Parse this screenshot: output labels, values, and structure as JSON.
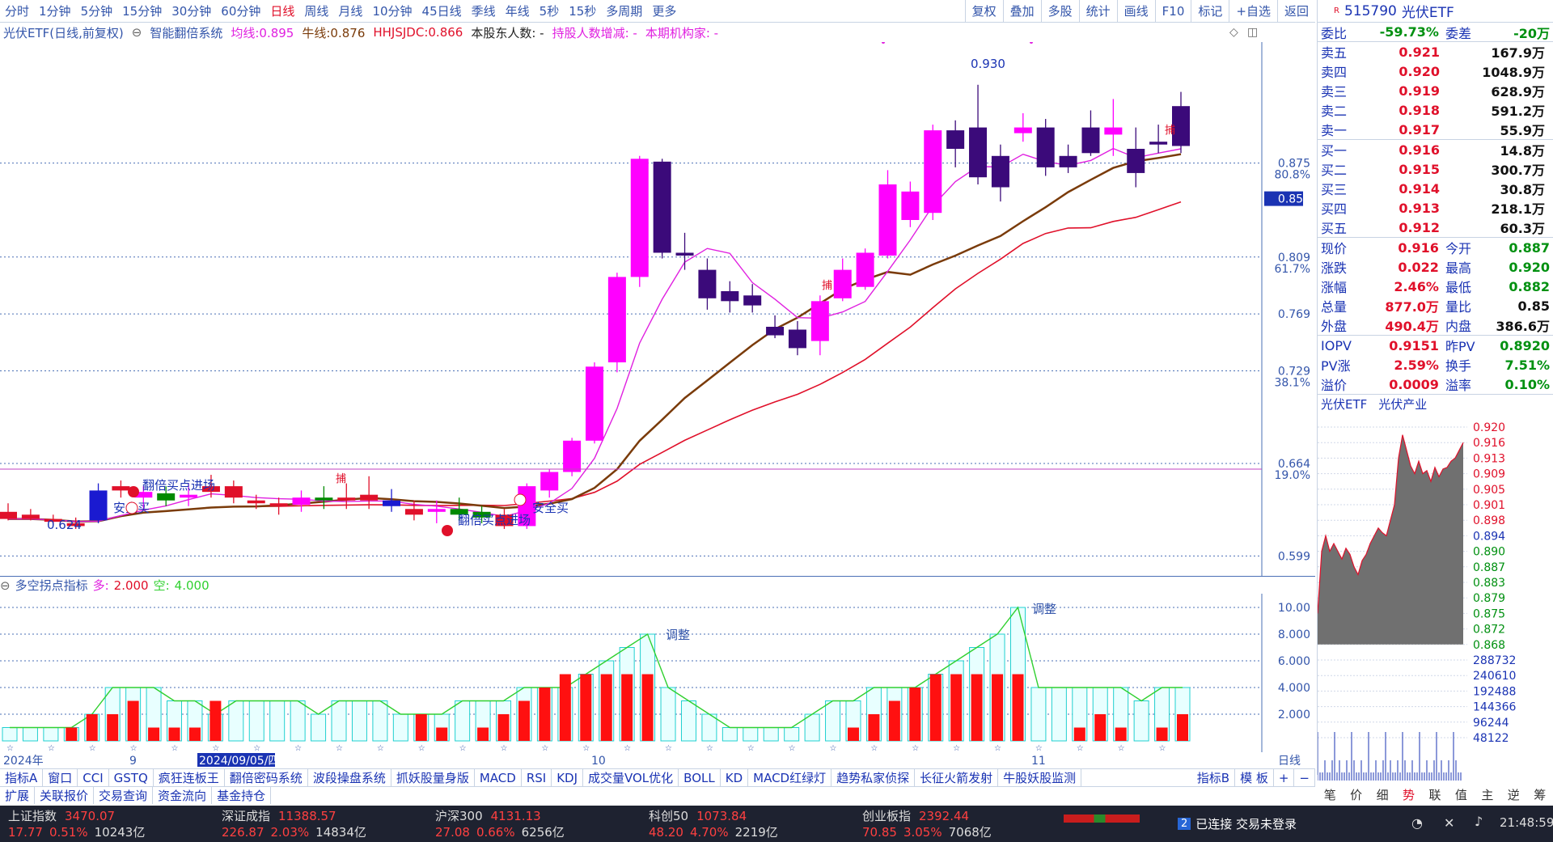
{
  "topbar": {
    "periods": [
      "分时",
      "1分钟",
      "5分钟",
      "15分钟",
      "30分钟",
      "60分钟",
      "日线",
      "周线",
      "月线",
      "10分钟",
      "45日线",
      "季线",
      "年线",
      "5秒",
      "15秒",
      "多周期",
      "更多"
    ],
    "active_period": "日线",
    "tools": [
      "复权",
      "叠加",
      "多股",
      "统计",
      "画线",
      "F10",
      "标记",
      "+自选",
      "返回"
    ]
  },
  "title": {
    "name": "光伏ETF(日线,前复权)",
    "system": "智能翻倍系统",
    "ma_label": "均线:",
    "ma_value": "0.895",
    "niu_label": "牛线:",
    "niu_value": "0.876",
    "hh_label": "HHJSJDC:",
    "hh_value": "0.866",
    "holders": "本股东人数: -",
    "holders_change": "持股人数增减: -",
    "inst": "本期机构家: -"
  },
  "price_axis": [
    "0.930",
    "0.875",
    "80.8%",
    "0.850",
    "0.809",
    "61.7%",
    "0.769",
    "0.729",
    "38.1%",
    "0.664",
    "19.0%",
    "0.599"
  ],
  "annotations": {
    "low_label": "0.624",
    "high_label": "0.930",
    "safe_buy_1": "安全买",
    "safe_buy_2": "安全买",
    "buy_point_1": "翻倍买点进场",
    "buy_point_2": "翻倍买点进场",
    "catch_1": "捕",
    "catch_2": "捕",
    "catch_3": "捕"
  },
  "chart_data": {
    "type": "candlestick",
    "title": "光伏ETF(日线,前复权)",
    "ohlc": [
      [
        0.63,
        0.636,
        0.624,
        0.625
      ],
      [
        0.628,
        0.632,
        0.624,
        0.625
      ],
      [
        0.625,
        0.628,
        0.621,
        0.623
      ],
      [
        0.622,
        0.626,
        0.618,
        0.62
      ],
      [
        0.645,
        0.65,
        0.622,
        0.624
      ],
      [
        0.648,
        0.652,
        0.64,
        0.645
      ],
      [
        0.64,
        0.648,
        0.632,
        0.644
      ],
      [
        0.643,
        0.648,
        0.634,
        0.638
      ],
      [
        0.64,
        0.65,
        0.634,
        0.642
      ],
      [
        0.648,
        0.656,
        0.64,
        0.644
      ],
      [
        0.648,
        0.652,
        0.636,
        0.64
      ],
      [
        0.638,
        0.642,
        0.632,
        0.636
      ],
      [
        0.636,
        0.64,
        0.628,
        0.634
      ],
      [
        0.635,
        0.645,
        0.63,
        0.64
      ],
      [
        0.64,
        0.648,
        0.632,
        0.638
      ],
      [
        0.64,
        0.65,
        0.632,
        0.638
      ],
      [
        0.642,
        0.655,
        0.632,
        0.638
      ],
      [
        0.638,
        0.646,
        0.63,
        0.634
      ],
      [
        0.632,
        0.638,
        0.624,
        0.628
      ],
      [
        0.63,
        0.638,
        0.622,
        0.632
      ],
      [
        0.632,
        0.64,
        0.624,
        0.628
      ],
      [
        0.63,
        0.634,
        0.622,
        0.626
      ],
      [
        0.628,
        0.632,
        0.618,
        0.62
      ],
      [
        0.62,
        0.65,
        0.618,
        0.648
      ],
      [
        0.645,
        0.66,
        0.64,
        0.658
      ],
      [
        0.658,
        0.682,
        0.655,
        0.68
      ],
      [
        0.68,
        0.735,
        0.678,
        0.732
      ],
      [
        0.735,
        0.798,
        0.728,
        0.795
      ],
      [
        0.795,
        0.88,
        0.788,
        0.878
      ],
      [
        0.876,
        0.878,
        0.808,
        0.812
      ],
      [
        0.812,
        0.826,
        0.8,
        0.81
      ],
      [
        0.8,
        0.808,
        0.772,
        0.78
      ],
      [
        0.785,
        0.792,
        0.77,
        0.778
      ],
      [
        0.782,
        0.79,
        0.77,
        0.775
      ],
      [
        0.76,
        0.768,
        0.752,
        0.754
      ],
      [
        0.758,
        0.764,
        0.74,
        0.745
      ],
      [
        0.75,
        0.782,
        0.74,
        0.778
      ],
      [
        0.78,
        0.808,
        0.778,
        0.8
      ],
      [
        0.788,
        0.815,
        0.786,
        0.812
      ],
      [
        0.81,
        0.87,
        0.808,
        0.86
      ],
      [
        0.835,
        0.862,
        0.83,
        0.855
      ],
      [
        0.84,
        0.902,
        0.835,
        0.898
      ],
      [
        0.898,
        0.905,
        0.872,
        0.885
      ],
      [
        0.9,
        0.93,
        0.86,
        0.865
      ],
      [
        0.88,
        0.888,
        0.848,
        0.858
      ],
      [
        0.896,
        0.91,
        0.89,
        0.9
      ],
      [
        0.9,
        0.906,
        0.866,
        0.872
      ],
      [
        0.88,
        0.888,
        0.868,
        0.872
      ],
      [
        0.9,
        0.912,
        0.88,
        0.882
      ],
      [
        0.895,
        0.92,
        0.88,
        0.9
      ],
      [
        0.885,
        0.9,
        0.858,
        0.868
      ],
      [
        0.89,
        0.902,
        0.882,
        0.888
      ],
      [
        0.915,
        0.925,
        0.882,
        0.887
      ]
    ],
    "ylim": [
      0.599,
      0.93
    ],
    "x_ticks": [
      "2024年",
      "9",
      "2024/09/05/四",
      "10",
      "11",
      "日线"
    ]
  },
  "indicator": {
    "name": "多空拐点指标",
    "duo_label": "多:",
    "duo_value": "2.000",
    "kong_label": "空:",
    "kong_value": "4.000",
    "axis": [
      "10.00",
      "8.000",
      "6.000",
      "4.000",
      "2.000"
    ],
    "adjust_1": "调整",
    "adjust_2": "调整"
  },
  "indicator_data": {
    "type": "bar",
    "duo": [
      0,
      0,
      0,
      1,
      2,
      2,
      3,
      1,
      1,
      1,
      3,
      0,
      0,
      0,
      0,
      0,
      0,
      0,
      0,
      0,
      2,
      1,
      0,
      1,
      2,
      3,
      4,
      5,
      5,
      5,
      5,
      5,
      0,
      0,
      0,
      0,
      0,
      0,
      0,
      0,
      0,
      1,
      2,
      3,
      4,
      5,
      5,
      5,
      5,
      5,
      0,
      0,
      1,
      2,
      1,
      0,
      1,
      2
    ],
    "kong": [
      1,
      1,
      1,
      1,
      2,
      4,
      4,
      4,
      3,
      3,
      2,
      3,
      3,
      3,
      3,
      2,
      3,
      3,
      3,
      2,
      2,
      2,
      3,
      3,
      3,
      4,
      4,
      4,
      5,
      6,
      7,
      8,
      4,
      3,
      2,
      1,
      1,
      1,
      1,
      2,
      3,
      3,
      4,
      4,
      4,
      5,
      6,
      7,
      8,
      10,
      4,
      4,
      4,
      4,
      4,
      3,
      4,
      4
    ]
  },
  "indicator_tabs": [
    "指标A",
    "窗口",
    "CCI",
    "GSTQ",
    "疯狂连板王",
    "翻倍密码系统",
    "波段操盘系统",
    "抓妖股量身版",
    "MACD",
    "RSI",
    "KDJ",
    "成交量VOL优化",
    "BOLL",
    "KD",
    "MACD红绿灯",
    "趋势私家侦探",
    "长征火箭发射",
    "牛股妖股监测"
  ],
  "indicator_tabs_right": [
    "指标B",
    "模 板",
    "+",
    "−"
  ],
  "sub_tabs": [
    "扩展",
    "关联报价",
    "交易查询",
    "资金流向",
    "基金持仓"
  ],
  "right_panel": {
    "code": "515790",
    "name": "光伏ETF",
    "ratio_label": "委比",
    "ratio_value": "-59.73%",
    "diff_label": "委差",
    "diff_value": "-20万",
    "asks": [
      {
        "label": "卖五",
        "price": "0.921",
        "vol": "167.9万"
      },
      {
        "label": "卖四",
        "price": "0.920",
        "vol": "1048.9万"
      },
      {
        "label": "卖三",
        "price": "0.919",
        "vol": "628.9万"
      },
      {
        "label": "卖二",
        "price": "0.918",
        "vol": "591.2万"
      },
      {
        "label": "卖一",
        "price": "0.917",
        "vol": "55.9万"
      }
    ],
    "bids": [
      {
        "label": "买一",
        "price": "0.916",
        "vol": "14.8万"
      },
      {
        "label": "买二",
        "price": "0.915",
        "vol": "300.7万"
      },
      {
        "label": "买三",
        "price": "0.914",
        "vol": "30.8万"
      },
      {
        "label": "买四",
        "price": "0.913",
        "vol": "218.1万"
      },
      {
        "label": "买五",
        "price": "0.912",
        "vol": "60.3万"
      }
    ],
    "stats": [
      {
        "l1": "现价",
        "v1": "0.916",
        "l2": "今开",
        "v2": "0.887"
      },
      {
        "l1": "涨跌",
        "v1": "0.022",
        "l2": "最高",
        "v2": "0.920"
      },
      {
        "l1": "涨幅",
        "v1": "2.46%",
        "l2": "最低",
        "v2": "0.882"
      },
      {
        "l1": "总量",
        "v1": "877.0万",
        "l2": "量比",
        "v2": "0.85"
      },
      {
        "l1": "外盘",
        "v1": "490.4万",
        "l2": "内盘",
        "v2": "386.6万"
      }
    ],
    "iopv": [
      {
        "l1": "IOPV",
        "v1": "0.9151",
        "l2": "昨PV",
        "v2": "0.8920"
      },
      {
        "l1": "PV涨",
        "v1": "2.59%",
        "l2": "换手",
        "v2": "7.51%"
      },
      {
        "l1": "溢价",
        "v1": "0.0009",
        "l2": "溢率",
        "v2": "0.10%"
      }
    ],
    "mini_tabs": [
      "光伏ETF",
      "光伏产业"
    ],
    "mini_axis": [
      "0.920",
      "0.916",
      "0.913",
      "0.909",
      "0.905",
      "0.901",
      "0.898",
      "0.894",
      "0.890",
      "0.887",
      "0.883",
      "0.879",
      "0.875",
      "0.872",
      "0.868",
      "288732",
      "240610",
      "192488",
      "144366",
      "96244",
      "48122"
    ],
    "bottom_tabs": [
      "笔",
      "价",
      "细",
      "势",
      "联",
      "值",
      "主",
      "逆",
      "筹"
    ]
  },
  "status": {
    "indices": [
      {
        "name": "上证指数",
        "value": "3470.07",
        "chg": "17.77",
        "pct": "0.51%",
        "amt": "10243亿"
      },
      {
        "name": "深证成指",
        "value": "11388.57",
        "chg": "226.87",
        "pct": "2.03%",
        "amt": "14834亿"
      },
      {
        "name": "沪深300",
        "value": "4131.13",
        "chg": "27.08",
        "pct": "0.66%",
        "amt": "6256亿"
      },
      {
        "name": "科创50",
        "value": "1073.84",
        "chg": "48.20",
        "pct": "4.70%",
        "amt": "2219亿"
      },
      {
        "name": "创业板指",
        "value": "2392.44",
        "chg": "70.85",
        "pct": "3.05%",
        "amt": "7068亿"
      }
    ],
    "conn_badge": "2",
    "connection": "已连接 交易未登录",
    "time": "21:48:59"
  }
}
